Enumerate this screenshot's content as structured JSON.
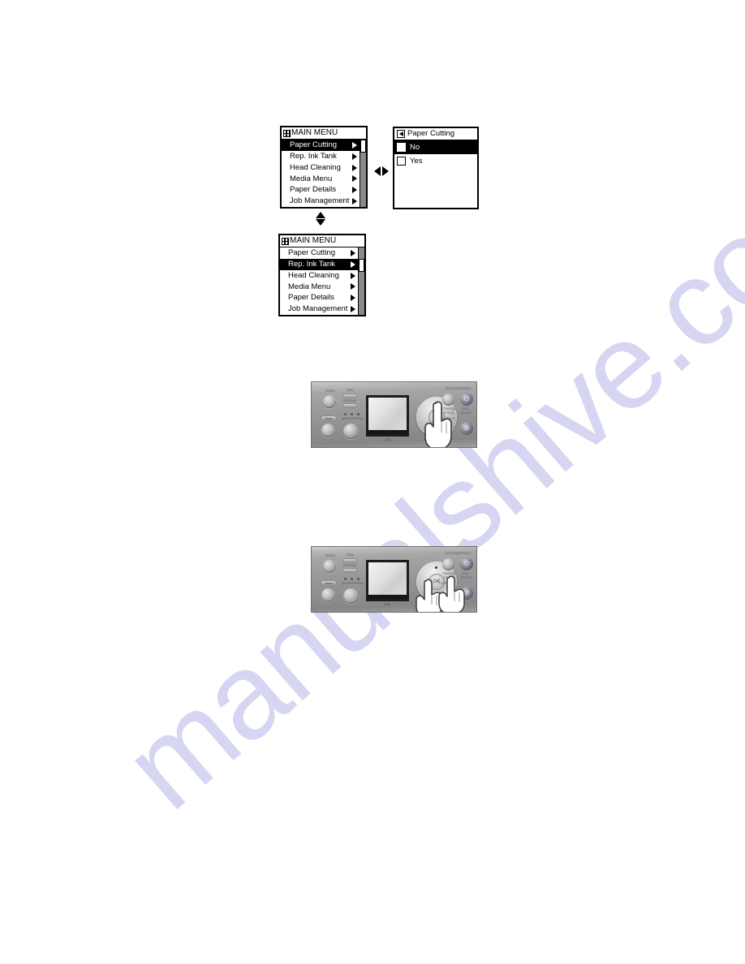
{
  "page": {
    "background_color": "#ffffff",
    "watermark": {
      "text": "manualshive.com",
      "color": "#d6d6f2"
    }
  },
  "main_menu_1": {
    "icon": "menu-grid-icon",
    "title": "MAIN MENU",
    "selected_index": 0,
    "items": [
      {
        "label": "Paper Cutting",
        "has_submenu_arrow": true
      },
      {
        "label": "Rep. Ink Tank",
        "has_submenu_arrow": true
      },
      {
        "label": "Head Cleaning",
        "has_submenu_arrow": true
      },
      {
        "label": "Media Menu",
        "has_submenu_arrow": true
      },
      {
        "label": "Paper Details",
        "has_submenu_arrow": true
      },
      {
        "label": "Job Management",
        "has_submenu_arrow": true
      }
    ]
  },
  "main_menu_2": {
    "icon": "menu-grid-icon",
    "title": "MAIN MENU",
    "selected_index": 1,
    "items": [
      {
        "label": "Paper Cutting",
        "has_submenu_arrow": true
      },
      {
        "label": "Rep. Ink Tank",
        "has_submenu_arrow": true
      },
      {
        "label": "Head Cleaning",
        "has_submenu_arrow": true
      },
      {
        "label": "Media Menu",
        "has_submenu_arrow": true
      },
      {
        "label": "Paper Details",
        "has_submenu_arrow": true
      },
      {
        "label": "Job Management",
        "has_submenu_arrow": true
      }
    ]
  },
  "submenu": {
    "back_icon": "back-arrow-icon",
    "title": "Paper Cutting",
    "selected_index": 0,
    "options": [
      {
        "label": "No",
        "checked": false
      },
      {
        "label": "Yes",
        "checked": false
      }
    ]
  },
  "connectors": {
    "left_right": {
      "left_icon": "triangle-left-icon",
      "right_icon": "triangle-right-icon"
    },
    "up_down": {
      "up_icon": "triangle-up-icon",
      "down_icon": "triangle-down-icon"
    }
  },
  "control_panel_1": {
    "labels": {
      "online": "Online",
      "data": "Data",
      "message": "Message",
      "menu": "Menu",
      "information": "Information",
      "power": "Power",
      "cleaning": "Cleaning",
      "feed": "(Feed)",
      "load_eject": "Load/Eject",
      "stop": "Stop",
      "reset": "(Reset)",
      "screen": "LCD",
      "ok": "OK"
    },
    "power_glyph": "⏻",
    "stop_glyph": "⊘",
    "hand_count": 1
  },
  "control_panel_2": {
    "labels": {
      "online": "Online",
      "data": "Data",
      "message": "Message",
      "menu": "Menu",
      "information": "Information",
      "power": "Power",
      "cleaning": "Cleaning",
      "feed": "(Feed)",
      "load_eject": "Load/Eject",
      "stop": "Stop",
      "reset": "(Reset)",
      "screen": "LCD",
      "ok": "OK"
    },
    "power_glyph": "⏻",
    "stop_glyph": "⊘",
    "hand_count": 2
  }
}
